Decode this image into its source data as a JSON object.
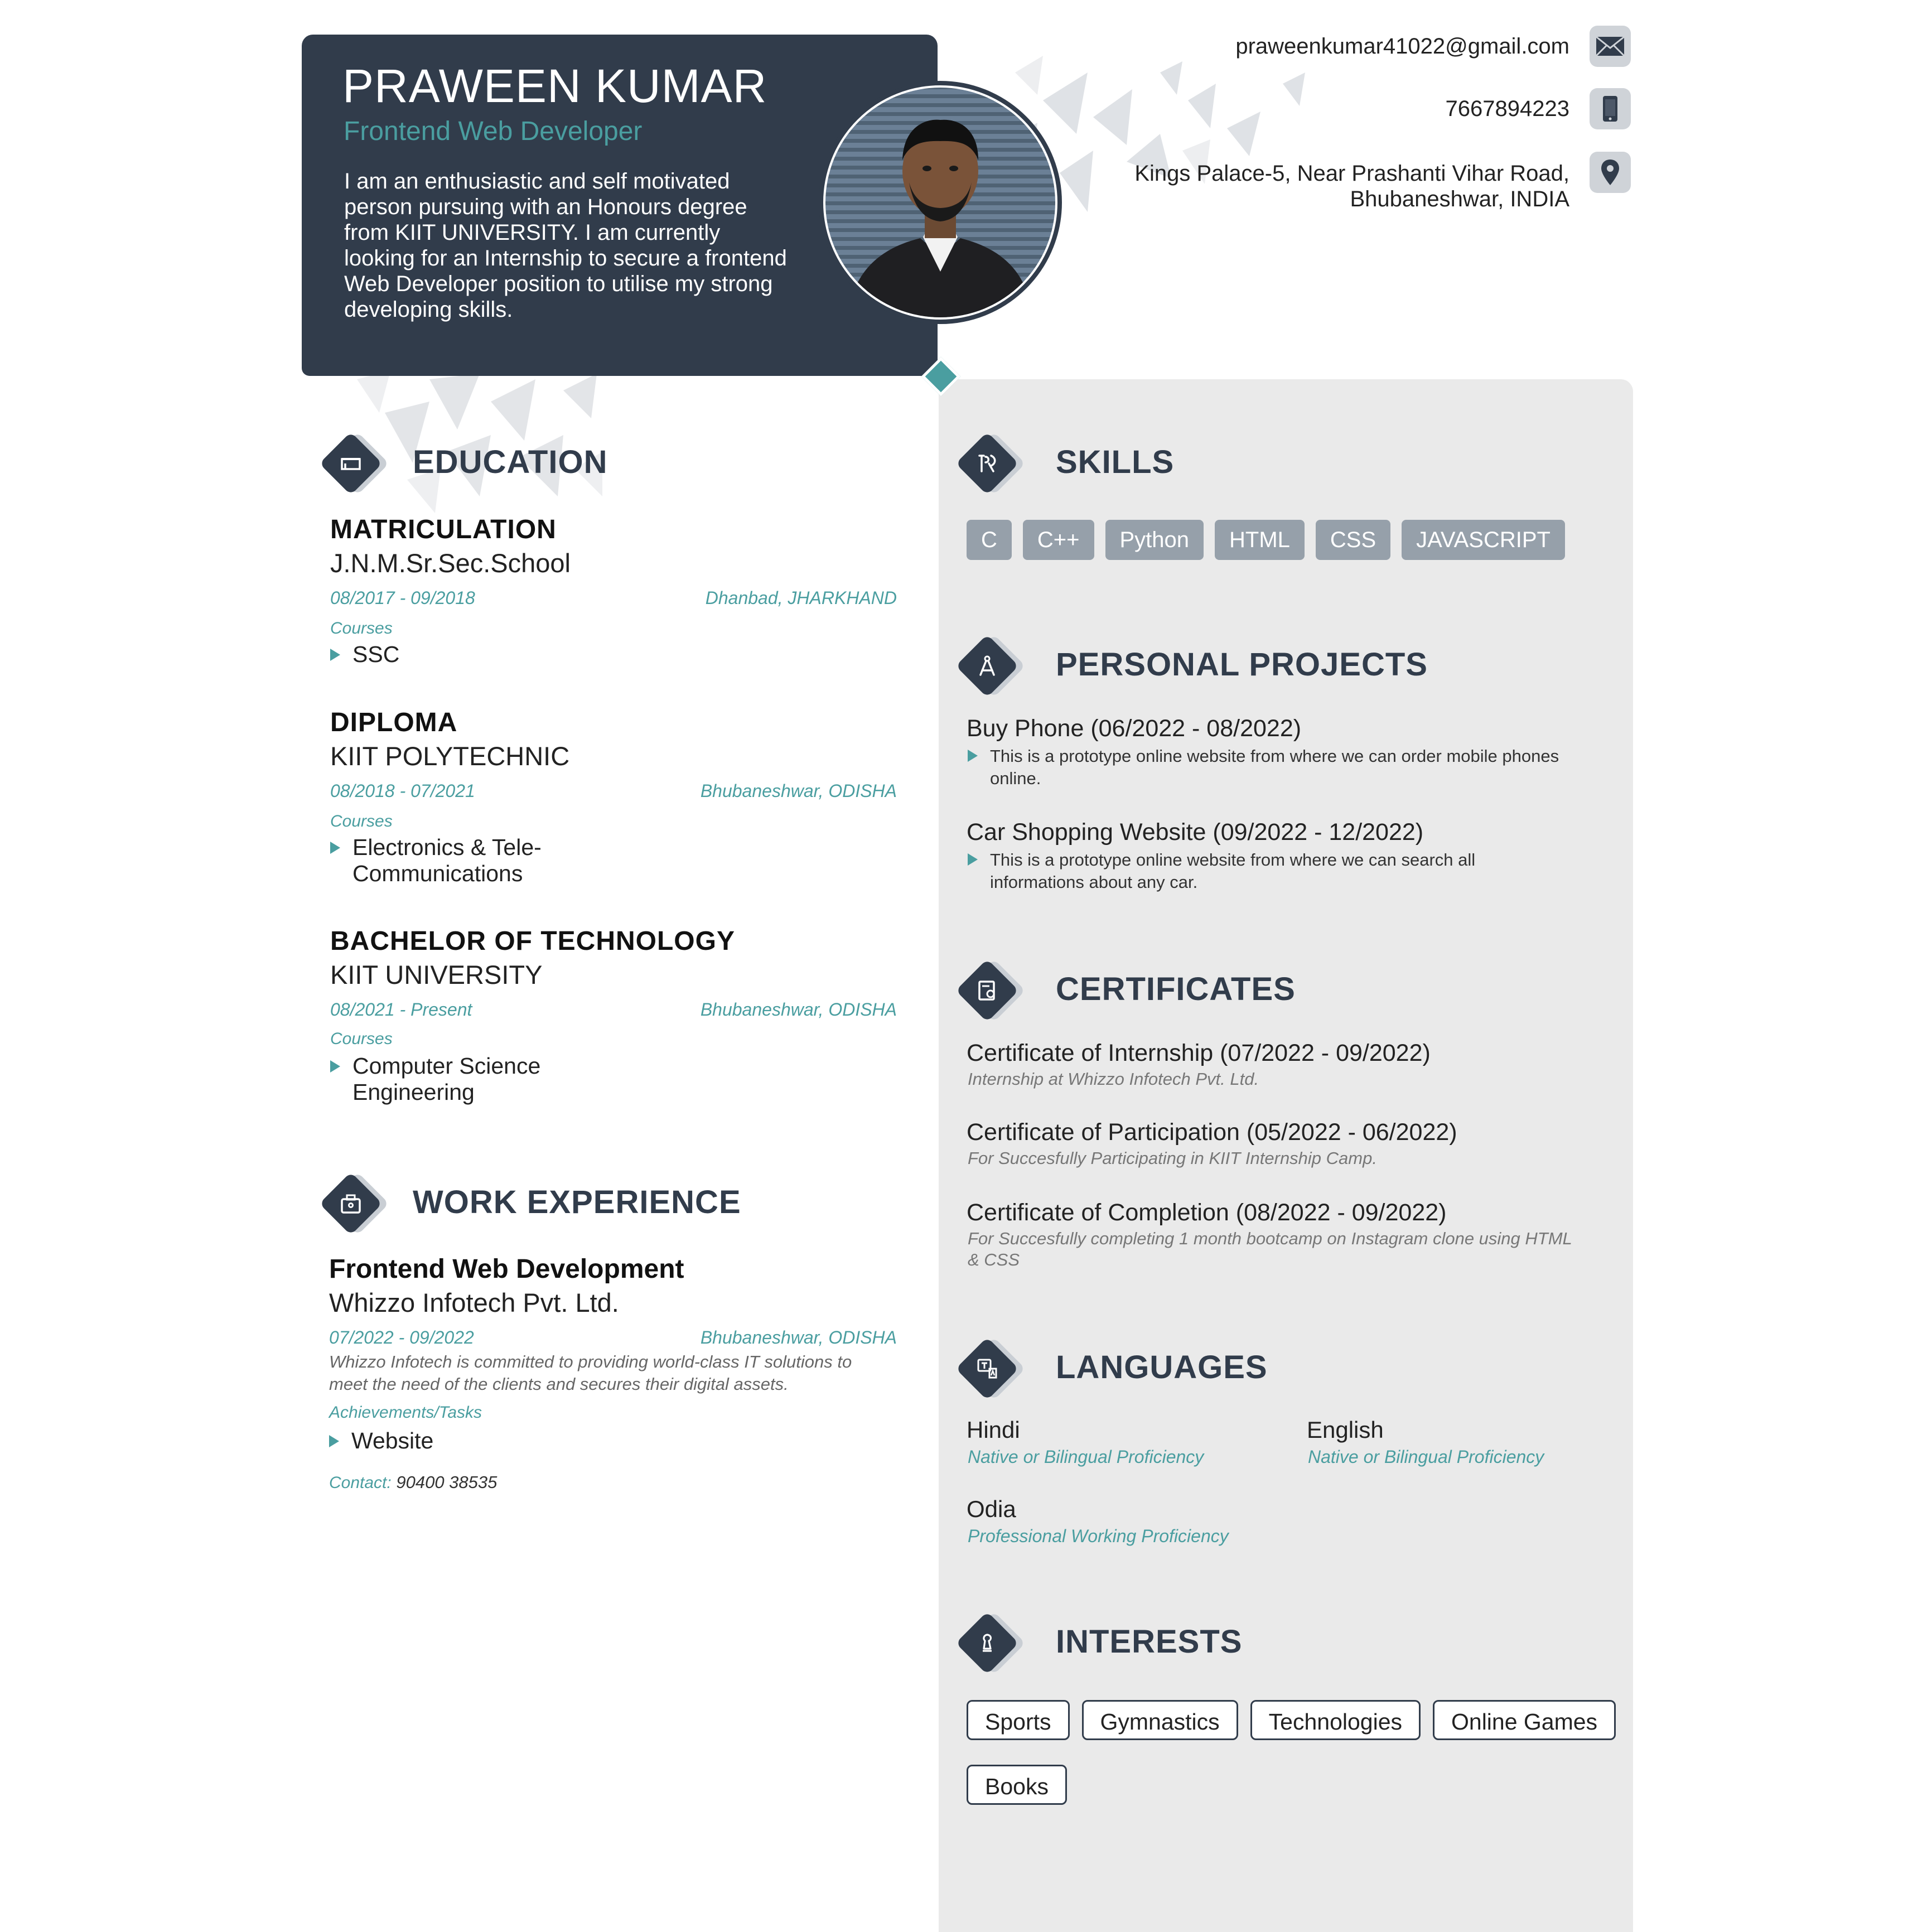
{
  "header": {
    "name": "PRAWEEN KUMAR",
    "title": "Frontend Web Developer",
    "summary": "I am an enthusiastic and self motivated person pursuing with an Honours degree from KIIT UNIVERSITY. I am currently looking for an Internship to secure a frontend Web Developer position to utilise my strong developing skills."
  },
  "contact": {
    "email": "praweenkumar41022@gmail.com",
    "phone": "7667894223",
    "address_line1": "Kings Palace-5, Near Prashanti Vihar Road,",
    "address_line2": "Bhubaneshwar, INDIA",
    "icons": [
      "envelope-icon",
      "phone-icon",
      "location-pin-icon"
    ]
  },
  "education": {
    "heading": "EDUCATION",
    "entries": [
      {
        "degree": "MATRICULATION",
        "school": "J.N.M.Sr.Sec.School",
        "dates": "08/2017 - 09/2018",
        "location": "Dhanbad, JHARKHAND",
        "courses_label": "Courses",
        "courses": [
          "SSC"
        ]
      },
      {
        "degree": "DIPLOMA",
        "school": "KIIT POLYTECHNIC",
        "dates": "08/2018 - 07/2021",
        "location": "Bhubaneshwar, ODISHA",
        "courses_label": "Courses",
        "courses": [
          "Electronics & Tele-",
          "Communications"
        ]
      },
      {
        "degree": "BACHELOR OF TECHNOLOGY",
        "school": "KIIT UNIVERSITY",
        "dates": "08/2021 - Present",
        "location": "Bhubaneshwar, ODISHA",
        "courses_label": "Courses",
        "courses": [
          "Computer Science",
          "Engineering"
        ]
      }
    ]
  },
  "work": {
    "heading": "WORK EXPERIENCE",
    "role": "Frontend Web Development",
    "company": "Whizzo Infotech Pvt. Ltd.",
    "dates": "07/2022 - 09/2022",
    "location": "Bhubaneshwar, ODISHA",
    "description_line1": "Whizzo Infotech is committed to providing world-class IT solutions to",
    "description_line2": "meet the need of the clients and secures their digital assets.",
    "achievements_label": "Achievements/Tasks",
    "achievements": [
      "Website"
    ],
    "contact_label": "Contact:",
    "contact_value": "90400 38535"
  },
  "skills": {
    "heading": "SKILLS",
    "items": [
      "C",
      "C++",
      "Python",
      "HTML",
      "CSS",
      "JAVASCRIPT"
    ]
  },
  "projects": {
    "heading": "PERSONAL PROJECTS",
    "items": [
      {
        "title": "Buy Phone (06/2022 - 08/2022)",
        "desc_line1": "This is a prototype online website from where we can order mobile phones",
        "desc_line2": "online."
      },
      {
        "title": "Car Shopping Website (09/2022 - 12/2022)",
        "desc_line1": "This is a prototype online website from where we can search all",
        "desc_line2": "informations about any car."
      }
    ]
  },
  "certificates": {
    "heading": "CERTIFICATES",
    "items": [
      {
        "title": "Certificate of Internship (07/2022 - 09/2022)",
        "desc_line1": "Internship at Whizzo Infotech Pvt. Ltd.",
        "desc_line2": ""
      },
      {
        "title": "Certificate of Participation (05/2022 - 06/2022)",
        "desc_line1": "For Succesfully Participating in KIIT Internship Camp.",
        "desc_line2": ""
      },
      {
        "title": "Certificate of Completion (08/2022 - 09/2022)",
        "desc_line1": "For Succesfully completing 1 month bootcamp on Instagram clone using HTML",
        "desc_line2": "& CSS"
      }
    ]
  },
  "languages": {
    "heading": "LANGUAGES",
    "items": [
      {
        "name": "Hindi",
        "level": "Native or Bilingual Proficiency"
      },
      {
        "name": "English",
        "level": "Native or Bilingual Proficiency"
      },
      {
        "name": "Odia",
        "level": "Professional Working Proficiency"
      }
    ]
  },
  "interests": {
    "heading": "INTERESTS",
    "items": [
      "Sports",
      "Gymnastics",
      "Technologies",
      "Online Games",
      "Books"
    ]
  },
  "colors": {
    "dark": "#313c4b",
    "accent": "#4a9ea0",
    "panel": "#eaeaea",
    "chip": "#96a0aa"
  }
}
